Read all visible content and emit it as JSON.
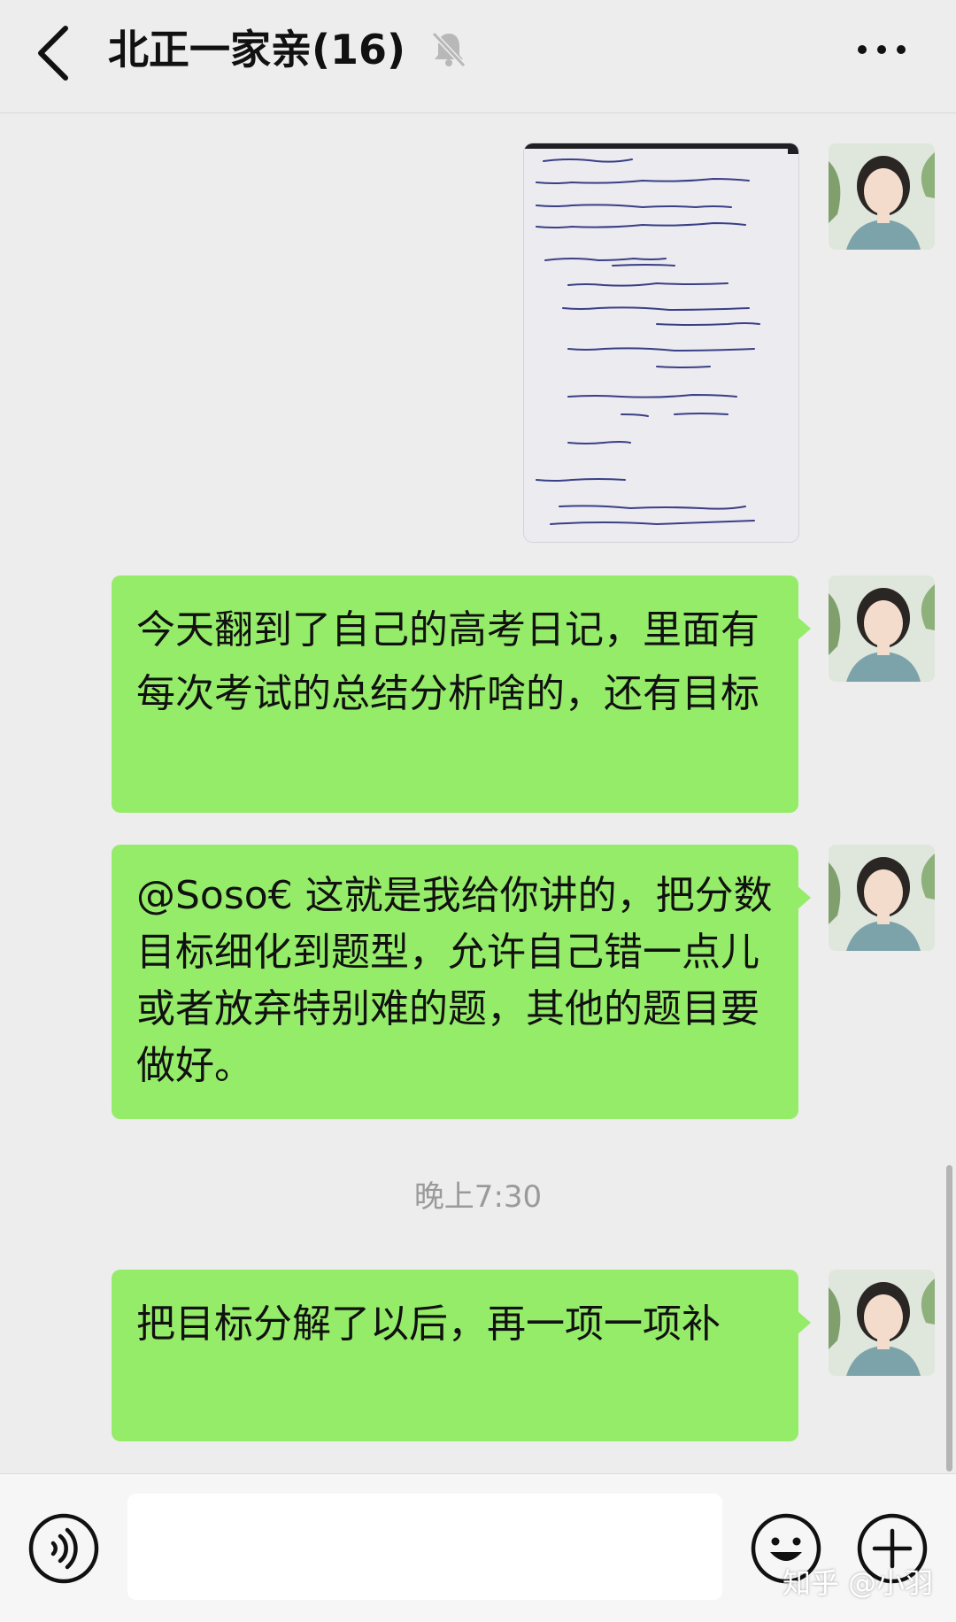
{
  "header": {
    "title": "北正一家亲(16)",
    "back_icon": "chevron-left-icon",
    "mute_icon": "bell-muted-icon",
    "more_icon": "more-dots-icon"
  },
  "messages": [
    {
      "type": "image",
      "icon": "handwritten-diary-photo"
    },
    {
      "type": "text",
      "text": "今天翻到了自己的高考日记，里面有每次考试的总结分析啥的，还有目标"
    },
    {
      "type": "text",
      "text": "@Soso€ 这就是我给你讲的，把分数目标细化到题型，允许自己错一点儿或者放弃特别难的题，其他的题目要做好。"
    },
    {
      "type": "text",
      "text": "把目标分解了以后，再一项一项补"
    }
  ],
  "timestamp": "晚上7:30",
  "input_bar": {
    "voice_icon": "voice-icon",
    "emoji_icon": "emoji-icon",
    "plus_icon": "plus-icon",
    "input_value": ""
  },
  "watermark": "知乎 @小羽",
  "colors": {
    "background": "#ededed",
    "bubble": "#95ec69",
    "input_bar": "#f6f6f6"
  }
}
